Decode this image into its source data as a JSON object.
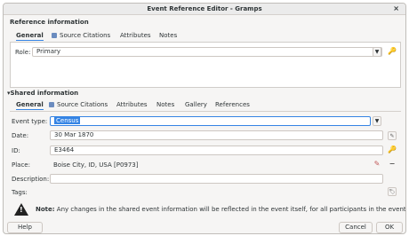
{
  "window": {
    "title": "Event Reference Editor - Gramps",
    "close_icon": "×"
  },
  "reference": {
    "heading": "Reference information",
    "tabs": [
      {
        "label": "General"
      },
      {
        "label": "Source Citations"
      },
      {
        "label": "Attributes"
      },
      {
        "label": "Notes"
      }
    ],
    "role_label": "Role:",
    "role_value": "Primary"
  },
  "shared": {
    "heading": "Shared information",
    "tabs": [
      {
        "label": "General"
      },
      {
        "label": "Source Citations"
      },
      {
        "label": "Attributes"
      },
      {
        "label": "Notes"
      },
      {
        "label": "Gallery"
      },
      {
        "label": "References"
      }
    ],
    "event_type_label": "Event type:",
    "event_type_value": "Census",
    "date_label": "Date:",
    "date_value": "30 Mar 1870",
    "id_label": "ID:",
    "id_value": "E3464",
    "place_label": "Place:",
    "place_value": "Boise City, ID, USA [P0973]",
    "description_label": "Description:",
    "description_value": "",
    "tags_label": "Tags:"
  },
  "note": {
    "bold": "Note:",
    "text": " Any changes in the shared event information will be reflected in the event itself, for all participants in the event."
  },
  "buttons": {
    "help": "Help",
    "cancel": "Cancel",
    "ok": "OK"
  }
}
